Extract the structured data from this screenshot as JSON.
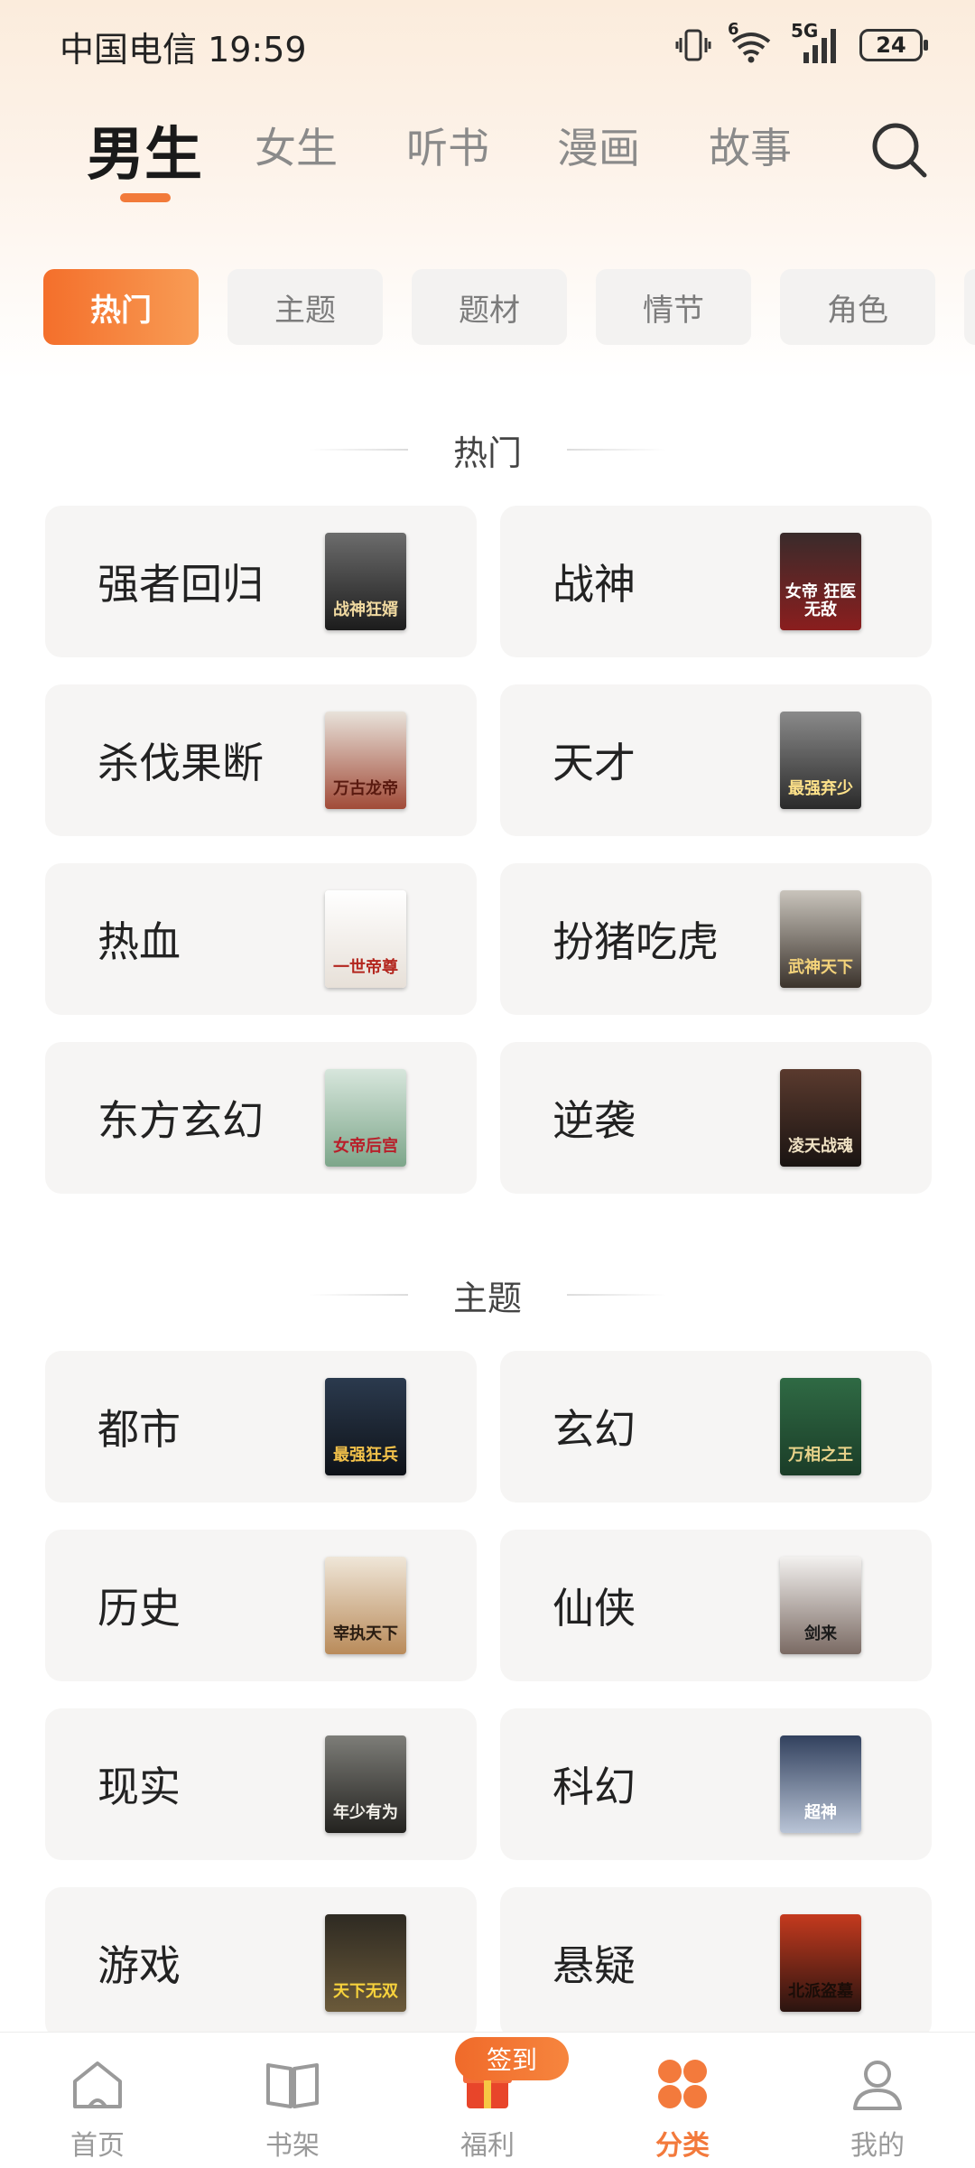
{
  "status_bar": {
    "carrier_time": "中国电信 19:59",
    "network": "5G",
    "sim": "6",
    "battery": "24"
  },
  "top_tabs": [
    "男生",
    "女生",
    "听书",
    "漫画",
    "故事"
  ],
  "active_top_tab": "男生",
  "chips": [
    "热门",
    "主题",
    "题材",
    "情节",
    "角色"
  ],
  "active_chip": "热门",
  "sections": [
    {
      "title": "热门",
      "items": [
        {
          "label": "强者回归",
          "cover_text": "战神狂婿"
        },
        {
          "label": "战神",
          "cover_text": "女帝 狂医无敌"
        },
        {
          "label": "杀伐果断",
          "cover_text": "万古龙帝"
        },
        {
          "label": "天才",
          "cover_text": "最强弃少"
        },
        {
          "label": "热血",
          "cover_text": "一世帝尊"
        },
        {
          "label": "扮猪吃虎",
          "cover_text": "武神天下"
        },
        {
          "label": "东方玄幻",
          "cover_text": "女帝后宫"
        },
        {
          "label": "逆袭",
          "cover_text": "凌天战魂"
        }
      ]
    },
    {
      "title": "主题",
      "items": [
        {
          "label": "都市",
          "cover_text": "最强狂兵"
        },
        {
          "label": "玄幻",
          "cover_text": "万相之王"
        },
        {
          "label": "历史",
          "cover_text": "宰执天下"
        },
        {
          "label": "仙侠",
          "cover_text": "剑来"
        },
        {
          "label": "现实",
          "cover_text": "年少有为"
        },
        {
          "label": "科幻",
          "cover_text": "超神"
        },
        {
          "label": "游戏",
          "cover_text": "天下无双"
        },
        {
          "label": "悬疑",
          "cover_text": "北派盗墓"
        }
      ]
    }
  ],
  "bottom_nav": [
    {
      "label": "首页",
      "icon": "home-icon"
    },
    {
      "label": "书架",
      "icon": "bookshelf-icon"
    },
    {
      "label": "福利",
      "icon": "gift-icon"
    },
    {
      "label": "分类",
      "icon": "category-icon"
    },
    {
      "label": "我的",
      "icon": "profile-icon"
    }
  ],
  "active_nav": "分类",
  "checkin_badge": "签到",
  "colors": {
    "accent": "#f37a3c",
    "chip_active_start": "#f46f2b",
    "chip_active_end": "#f89c55",
    "card_bg": "#f6f5f4"
  }
}
